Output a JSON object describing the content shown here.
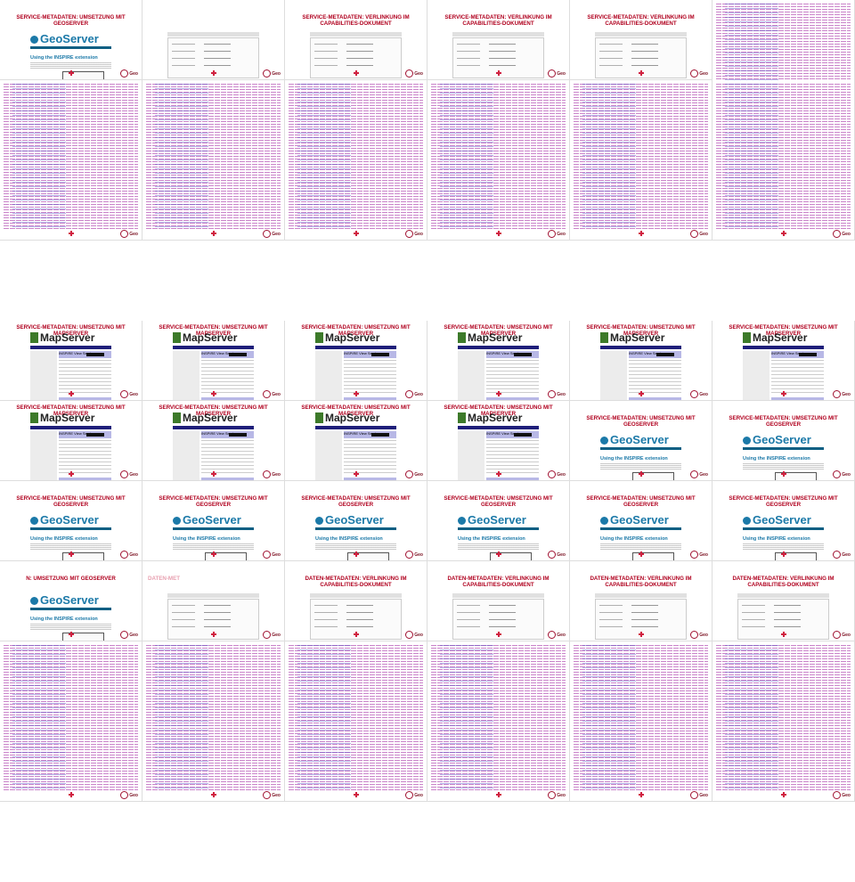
{
  "app": "Slide sorter overview",
  "logo_text": "Geo",
  "titles": {
    "gs": "SERVICE-METADATEN: UMSETZUNG MIT GEOSERVER",
    "ms": "SERVICE-METADATEN: UMSETZUNG MIT MAPSERVER",
    "cap": "SERVICE-METADATEN: VERLINKUNG IM CAPABILITIES-DOKUMENT",
    "daten": "DATEN-METADATEN: VERLINKUNG IM CAPABILITIES-DOKUMENT",
    "gs_partial": "N: UMSETZUNG MIT GEOSERVER",
    "daten_partial": "DATEN-MET"
  },
  "geoserver": {
    "logo": "GeoServer",
    "heading": "Using the INSPIRE extension",
    "link": "Extended WMS and WMTS configuration"
  },
  "mapserver": {
    "logo": "MapServer",
    "heading": "INSPIRE View Service"
  },
  "tiles": [
    {
      "kind": "gs"
    },
    {
      "kind": "form"
    },
    {
      "kind": "cap"
    },
    {
      "kind": "cap"
    },
    {
      "kind": "cap"
    },
    {
      "kind": "xml"
    },
    {
      "kind": "xml"
    },
    {
      "kind": "xml"
    },
    {
      "kind": "xml"
    },
    {
      "kind": "xml"
    },
    {
      "kind": "xml"
    },
    {
      "kind": "xml"
    },
    {
      "kind": "ms"
    },
    {
      "kind": "ms"
    },
    {
      "kind": "ms"
    },
    {
      "kind": "ms"
    },
    {
      "kind": "ms"
    },
    {
      "kind": "ms"
    },
    {
      "kind": "ms"
    },
    {
      "kind": "ms"
    },
    {
      "kind": "ms"
    },
    {
      "kind": "ms"
    },
    {
      "kind": "gs"
    },
    {
      "kind": "gs"
    },
    {
      "kind": "gs"
    },
    {
      "kind": "gs"
    },
    {
      "kind": "gs"
    },
    {
      "kind": "gs"
    },
    {
      "kind": "gs"
    },
    {
      "kind": "gs"
    },
    {
      "kind": "gs_partial"
    },
    {
      "kind": "daten_partial"
    },
    {
      "kind": "daten"
    },
    {
      "kind": "daten"
    },
    {
      "kind": "daten"
    },
    {
      "kind": "daten"
    },
    {
      "kind": "xml"
    },
    {
      "kind": "xml"
    },
    {
      "kind": "xml"
    },
    {
      "kind": "xml"
    },
    {
      "kind": "xml"
    },
    {
      "kind": "xml"
    }
  ]
}
